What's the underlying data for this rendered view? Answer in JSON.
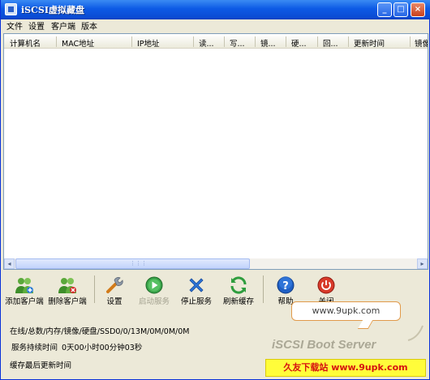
{
  "window": {
    "title": "iSCSI虚拟藏盘"
  },
  "titlebar": {
    "min": "_",
    "max": "□",
    "close": "×"
  },
  "menu": [
    "文件",
    "设置",
    "客户端",
    "版本"
  ],
  "listview": {
    "columns": [
      "计算机名",
      "MAC地址",
      "IP地址",
      "读...",
      "写...",
      "镜...",
      "硬...",
      "回...",
      "更新时间",
      "镜像"
    ]
  },
  "scroll": {
    "left": "◂",
    "right": "▸",
    "grip": "⋮⋮⋮"
  },
  "toolbar": {
    "add_client": "添加客户端",
    "delete_client": "删除客户端",
    "settings": "设置",
    "start_service": "启动服务",
    "stop_service": "停止服务",
    "refresh_cache": "刷新缓存",
    "help": "帮助",
    "close": "关闭"
  },
  "status": {
    "online_line": "在线/总数/内存/镜像/硬盘/SSD0/0/13M/0M/0M/0M",
    "uptime_label": "服务持续时间",
    "uptime_value": "0天00小时00分钟03秒",
    "cache_update": "缓存最后更新时间",
    "product": "iSCSI Boot Server"
  },
  "watermarks": {
    "bubble": "www.9upk.com",
    "banner": "久友下载站 www.9upk.com"
  },
  "colors": {
    "title_bar": "#0d5ae5",
    "window_bg": "#ece9d8",
    "banner_bg": "#fffd3a",
    "banner_text": "#d61010"
  }
}
